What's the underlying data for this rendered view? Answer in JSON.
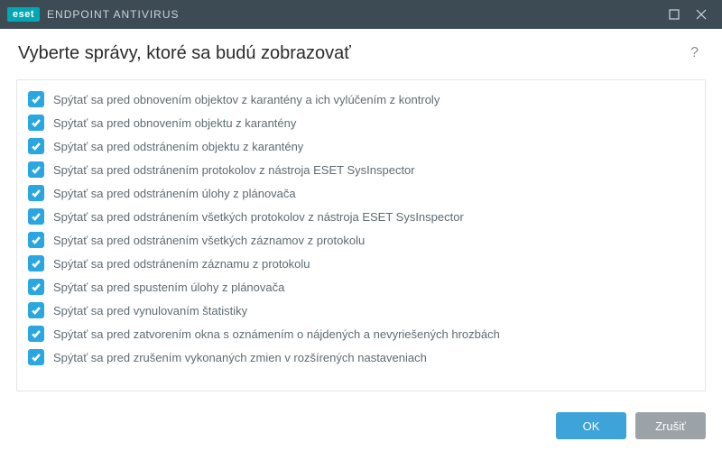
{
  "titlebar": {
    "brand_badge": "eset",
    "brand_text": "ENDPOINT ANTIVIRUS"
  },
  "header": {
    "title": "Vyberte správy, ktoré sa budú zobrazovať",
    "help_symbol": "?"
  },
  "items": [
    {
      "checked": true,
      "label": "Spýtať sa pred obnovením objektov z karantény a ich vylúčením z kontroly"
    },
    {
      "checked": true,
      "label": "Spýtať sa pred obnovením objektu z karantény"
    },
    {
      "checked": true,
      "label": "Spýtať sa pred odstránením objektu z karantény"
    },
    {
      "checked": true,
      "label": "Spýtať sa pred odstránením protokolov z nástroja ESET SysInspector"
    },
    {
      "checked": true,
      "label": "Spýtať sa pred odstránením úlohy z plánovača"
    },
    {
      "checked": true,
      "label": "Spýtať sa pred odstránením všetkých protokolov z nástroja ESET SysInspector"
    },
    {
      "checked": true,
      "label": "Spýtať sa pred odstránením všetkých záznamov z protokolu"
    },
    {
      "checked": true,
      "label": "Spýtať sa pred odstránením záznamu z protokolu"
    },
    {
      "checked": true,
      "label": "Spýtať sa pred spustením úlohy z plánovača"
    },
    {
      "checked": true,
      "label": "Spýtať sa pred vynulovaním štatistiky"
    },
    {
      "checked": true,
      "label": "Spýtať sa pred zatvorením okna s oznámením o nájdených a nevyriešených hrozbách"
    },
    {
      "checked": true,
      "label": "Spýtať sa pred zrušením vykonaných zmien v rozšírených nastaveniach"
    }
  ],
  "footer": {
    "ok_label": "OK",
    "cancel_label": "Zrušiť"
  }
}
